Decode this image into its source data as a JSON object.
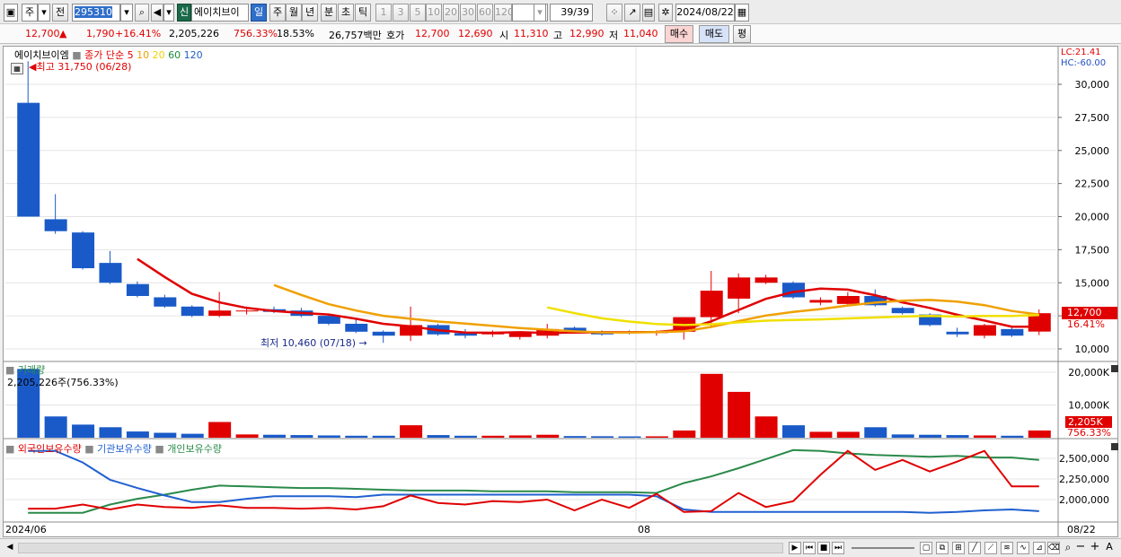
{
  "toolbar": {
    "period": "주",
    "prev_label": "전",
    "stock_code": "295310",
    "credit_badge": "신",
    "stock_name": "에이치브이",
    "periods": [
      "일",
      "주",
      "월",
      "년",
      "분",
      "초",
      "틱"
    ],
    "active_period": "일",
    "intervals": [
      "1",
      "3",
      "5",
      "10",
      "20",
      "30",
      "60",
      "120"
    ],
    "count": "39/39",
    "date": "2024/08/22"
  },
  "info": {
    "price": "12,700",
    "change": "1,790",
    "change_pct": "+16.41%",
    "volume": "2,205,226",
    "vol_ratio": "756.33%",
    "turnover": "18.53%",
    "trade_value": "26,757백만",
    "quote_label": "호가",
    "ask": "12,700",
    "bid": "12,690",
    "open_label": "시",
    "open": "11,310",
    "high_label": "고",
    "high": "12,990",
    "low_label": "저",
    "low": "11,040",
    "buy_label": "매수",
    "sell_label": "매도",
    "avg_label": "평"
  },
  "price_panel": {
    "name": "에이치브이엠",
    "ma_label": "종가 단순",
    "ma_periods": [
      "5",
      "10",
      "20",
      "60",
      "120"
    ],
    "ma_colors": [
      "#e00000",
      "#f0a000",
      "#f0e000",
      "#1a8a3a",
      "#2060c0"
    ],
    "high_note": "최고 31,750 (06/28)",
    "low_note": "최저 10,460 (07/18)",
    "lc": "LC:21.41",
    "hc": "HC:-60.00",
    "axis_ticks": [
      "30,000",
      "27,500",
      "25,000",
      "22,500",
      "20,000",
      "17,500",
      "15,000",
      "10,000"
    ],
    "current_price": "12,700",
    "current_pct": "16.41%"
  },
  "volume_panel": {
    "title": "거래량",
    "note": "2,205,226주(756.33%)",
    "axis_ticks": [
      "20,000K",
      "10,000K"
    ],
    "current": "2,205K",
    "current_pct": "756.33%"
  },
  "holding_panel": {
    "series": [
      "외국인보유수량",
      "기관보유수량",
      "개인보유수량"
    ],
    "colors": [
      "#e00000",
      "#2060d0",
      "#2a8a4a"
    ],
    "axis_ticks": [
      "2,500,000",
      "2,250,000",
      "2,000,000"
    ]
  },
  "x_axis": {
    "left": "2024/06",
    "mid": "08",
    "right": "08/22"
  },
  "chart_data": {
    "type": "candlestick",
    "candles": [
      {
        "o": 28600,
        "h": 31750,
        "l": 20000,
        "c": 20000
      },
      {
        "o": 19800,
        "h": 21700,
        "l": 18700,
        "c": 18900
      },
      {
        "o": 18800,
        "h": 18900,
        "l": 16000,
        "c": 16100
      },
      {
        "o": 16500,
        "h": 17400,
        "l": 14900,
        "c": 15000
      },
      {
        "o": 14900,
        "h": 15100,
        "l": 13900,
        "c": 14000
      },
      {
        "o": 13900,
        "h": 14100,
        "l": 13100,
        "c": 13200
      },
      {
        "o": 13200,
        "h": 13300,
        "l": 12400,
        "c": 12500
      },
      {
        "o": 12500,
        "h": 14300,
        "l": 12400,
        "c": 12900
      },
      {
        "o": 12900,
        "h": 13200,
        "l": 12600,
        "c": 12900
      },
      {
        "o": 13000,
        "h": 13200,
        "l": 12700,
        "c": 12800
      },
      {
        "o": 12900,
        "h": 13100,
        "l": 12400,
        "c": 12500
      },
      {
        "o": 12500,
        "h": 12600,
        "l": 11800,
        "c": 11900
      },
      {
        "o": 11900,
        "h": 12200,
        "l": 11200,
        "c": 11300
      },
      {
        "o": 11300,
        "h": 11400,
        "l": 10460,
        "c": 11000
      },
      {
        "o": 11000,
        "h": 13200,
        "l": 10600,
        "c": 11800
      },
      {
        "o": 11800,
        "h": 11900,
        "l": 11000,
        "c": 11100
      },
      {
        "o": 11200,
        "h": 11500,
        "l": 10800,
        "c": 11000
      },
      {
        "o": 11100,
        "h": 11400,
        "l": 10900,
        "c": 11200
      },
      {
        "o": 10900,
        "h": 11300,
        "l": 10700,
        "c": 11200
      },
      {
        "o": 11000,
        "h": 11900,
        "l": 10800,
        "c": 11500
      },
      {
        "o": 11600,
        "h": 11700,
        "l": 11200,
        "c": 11300
      },
      {
        "o": 11300,
        "h": 11400,
        "l": 11000,
        "c": 11100
      },
      {
        "o": 11300,
        "h": 11400,
        "l": 11100,
        "c": 11200
      },
      {
        "o": 11200,
        "h": 11400,
        "l": 11000,
        "c": 11300
      },
      {
        "o": 11300,
        "h": 12400,
        "l": 10700,
        "c": 12400
      },
      {
        "o": 12400,
        "h": 15900,
        "l": 11700,
        "c": 14400
      },
      {
        "o": 13800,
        "h": 15700,
        "l": 12700,
        "c": 15400
      },
      {
        "o": 15000,
        "h": 15600,
        "l": 14900,
        "c": 15400
      },
      {
        "o": 15000,
        "h": 15100,
        "l": 13800,
        "c": 13900
      },
      {
        "o": 13500,
        "h": 13900,
        "l": 13300,
        "c": 13700
      },
      {
        "o": 13400,
        "h": 14300,
        "l": 13300,
        "c": 14000
      },
      {
        "o": 14000,
        "h": 14500,
        "l": 13200,
        "c": 13300
      },
      {
        "o": 13100,
        "h": 13200,
        "l": 12600,
        "c": 12700
      },
      {
        "o": 12600,
        "h": 12700,
        "l": 11700,
        "c": 11800
      },
      {
        "o": 11300,
        "h": 11600,
        "l": 10900,
        "c": 11100
      },
      {
        "o": 11000,
        "h": 11900,
        "l": 10800,
        "c": 11800
      },
      {
        "o": 11500,
        "h": 11600,
        "l": 10900,
        "c": 11000
      },
      {
        "o": 11310,
        "h": 12990,
        "l": 11040,
        "c": 12700
      }
    ],
    "volume_k": [
      21000,
      6500,
      4000,
      3200,
      1900,
      1500,
      1200,
      4800,
      1000,
      900,
      800,
      700,
      600,
      600,
      3800,
      800,
      600,
      600,
      700,
      900,
      500,
      450,
      400,
      420,
      2200,
      19500,
      14000,
      6500,
      3800,
      1800,
      1800,
      3200,
      1000,
      900,
      800,
      700,
      600,
      2205
    ],
    "foreign": [
      1890000,
      1890000,
      1940000,
      1880000,
      1940000,
      1910000,
      1900000,
      1930000,
      1900000,
      1900000,
      1890000,
      1900000,
      1880000,
      1920000,
      2050000,
      1960000,
      1940000,
      1980000,
      1970000,
      2000000,
      1870000,
      2000000,
      1900000,
      2070000,
      1850000,
      1860000,
      2080000,
      1910000,
      1980000,
      2300000,
      2590000,
      2360000,
      2480000,
      2340000,
      2460000,
      2590000,
      2160000,
      2160000
    ],
    "institution": [
      2590000,
      2590000,
      2450000,
      2240000,
      2140000,
      2050000,
      1970000,
      1970000,
      2010000,
      2040000,
      2040000,
      2040000,
      2030000,
      2060000,
      2060000,
      2060000,
      2060000,
      2060000,
      2060000,
      2060000,
      2060000,
      2060000,
      2060000,
      2040000,
      1880000,
      1850000,
      1850000,
      1850000,
      1850000,
      1850000,
      1850000,
      1850000,
      1850000,
      1840000,
      1850000,
      1870000,
      1880000,
      1860000
    ],
    "individual": [
      1840000,
      1840000,
      1840000,
      1940000,
      2010000,
      2060000,
      2120000,
      2170000,
      2160000,
      2150000,
      2140000,
      2140000,
      2130000,
      2120000,
      2110000,
      2110000,
      2110000,
      2100000,
      2100000,
      2100000,
      2090000,
      2090000,
      2090000,
      2080000,
      2200000,
      2280000,
      2380000,
      2490000,
      2600000,
      2590000,
      2560000,
      2540000,
      2530000,
      2520000,
      2530000,
      2510000,
      2510000,
      2480000
    ]
  }
}
